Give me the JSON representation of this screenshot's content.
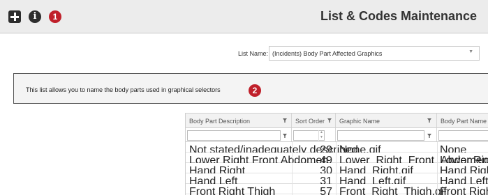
{
  "header": {
    "title": "List & Codes Maintenance",
    "add_icon": "plus-square-icon",
    "info_icon": "info-circle-icon",
    "marker_1": "1"
  },
  "list_name": {
    "label": "List Name:",
    "selected": "(Incidents) Body Part Affected Graphics"
  },
  "description": {
    "text": "This list allows you to name the body parts used in graphical selectors",
    "marker_2": "2"
  },
  "grid": {
    "columns": [
      "Body Part Description",
      "Sort Order",
      "Graphic Name",
      "Body Part Name"
    ],
    "rows": [
      [
        "Not stated/inadequately described",
        "29",
        "None.gif",
        "None"
      ],
      [
        "Lower Right Front Abdomen",
        "49",
        "Lower_Right_Front_Abdomen.gif",
        "Lower Right Front"
      ],
      [
        "Hand Right",
        "30",
        "Hand_Right.gif",
        "Hand Right"
      ],
      [
        "Hand Left",
        "31",
        "Hand_Left.gif",
        "Hand Left"
      ],
      [
        "Front Right Thigh",
        "57",
        "Front_Right_Thigh.gif",
        "Front Right Thigh"
      ]
    ]
  },
  "colors": {
    "marker": "#c0202a",
    "header_bg": "#ececec",
    "description_bg": "#f4f4f4"
  }
}
